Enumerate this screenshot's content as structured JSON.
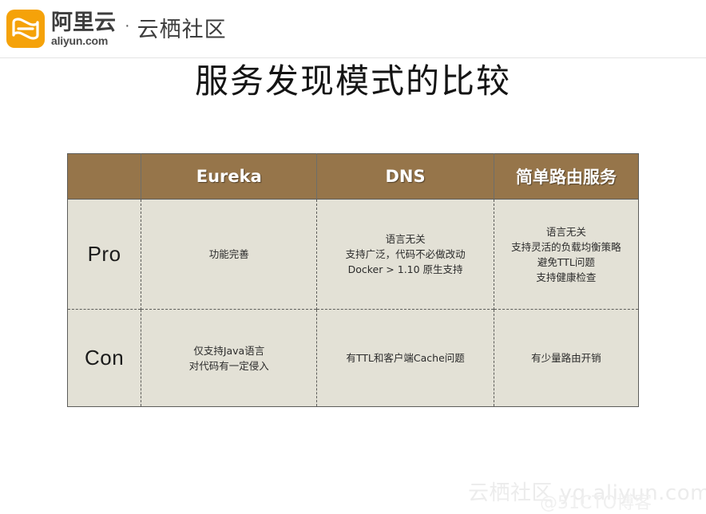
{
  "brand": {
    "logo_icon": "aliyun-cloud-logo-icon",
    "logo_color": "#f5a209",
    "name_cn": "阿里云",
    "name_en": "aliyun.com",
    "separator": "·",
    "community": "云栖社区"
  },
  "slide": {
    "title": "服务发现模式的比较"
  },
  "table": {
    "header_bg": "#96754A",
    "body_bg": "#E3E1D6",
    "columns": [
      {
        "label": ""
      },
      {
        "label": "Eureka"
      },
      {
        "label": "DNS"
      },
      {
        "label": "简单路由服务"
      }
    ],
    "rows": [
      {
        "label": "Pro",
        "cells": [
          [
            "功能完善"
          ],
          [
            "语言无关",
            "支持广泛，代码不必做改动",
            "Docker > 1.10 原生支持"
          ],
          [
            "语言无关",
            "支持灵活的负载均衡策略",
            "避免TTL问题",
            "支持健康检查"
          ]
        ]
      },
      {
        "label": "Con",
        "cells": [
          [
            "仅支持Java语言",
            "对代码有一定侵入"
          ],
          [
            "有TTL和客户端Cache问题"
          ],
          [
            "有少量路由开销"
          ]
        ]
      }
    ]
  },
  "watermarks": {
    "primary": "云栖社区 yq.aliyun.com",
    "secondary": "@51CTO博客"
  }
}
